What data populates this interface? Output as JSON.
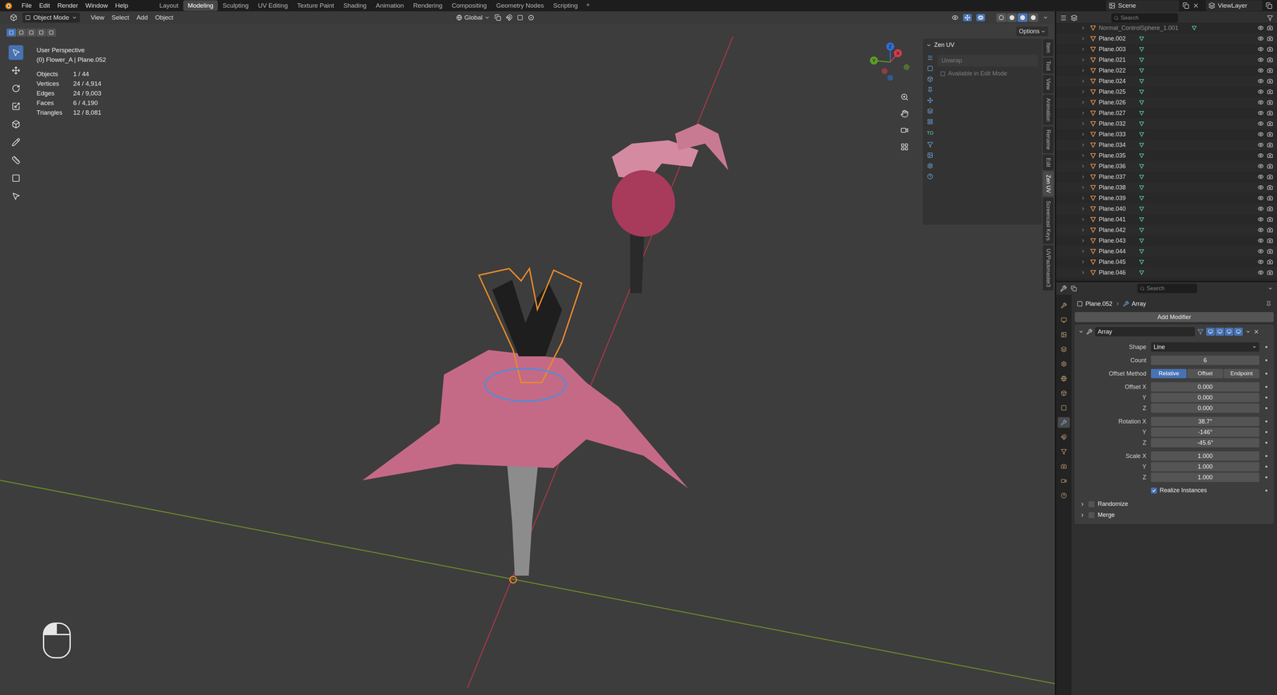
{
  "top_bar": {
    "menus": [
      "File",
      "Edit",
      "Render",
      "Window",
      "Help"
    ],
    "workspaces": [
      {
        "label": "Layout",
        "selected": false
      },
      {
        "label": "Modeling",
        "selected": true
      },
      {
        "label": "Sculpting",
        "selected": false
      },
      {
        "label": "UV Editing",
        "selected": false
      },
      {
        "label": "Texture Paint",
        "selected": false
      },
      {
        "label": "Shading",
        "selected": false
      },
      {
        "label": "Animation",
        "selected": false
      },
      {
        "label": "Rendering",
        "selected": false
      },
      {
        "label": "Compositing",
        "selected": false
      },
      {
        "label": "Geometry Nodes",
        "selected": false
      },
      {
        "label": "Scripting",
        "selected": false
      }
    ],
    "add_workspace": "+",
    "scene": "Scene",
    "view_layer": "ViewLayer"
  },
  "viewport": {
    "header": {
      "mode": "Object Mode",
      "menus": [
        "View",
        "Select",
        "Add",
        "Object"
      ],
      "orientation": "Global",
      "options": "Options",
      "shading": [
        {
          "selected": false
        },
        {
          "selected": false
        },
        {
          "selected": true
        },
        {
          "selected": false
        }
      ]
    },
    "select_modes": [
      {
        "selected": true
      },
      {
        "selected": false
      },
      {
        "selected": false
      },
      {
        "selected": false
      },
      {
        "selected": false
      }
    ],
    "tools": [
      {
        "selected": true
      },
      {
        "selected": false
      },
      {
        "selected": false
      },
      {
        "selected": false
      },
      {
        "selected": false
      },
      {
        "selected": false
      },
      {
        "selected": false
      },
      {
        "selected": false
      },
      {
        "selected": false
      }
    ],
    "overlay": {
      "perspective": "User Perspective",
      "context": "(0) Flower_A | Plane.052",
      "stats": [
        {
          "label": "Objects",
          "value": "1 / 44"
        },
        {
          "label": "Vertices",
          "value": "24 / 4,914"
        },
        {
          "label": "Edges",
          "value": "24 / 9,003"
        },
        {
          "label": "Faces",
          "value": "6 / 4,190"
        },
        {
          "label": "Triangles",
          "value": "12 / 8,081"
        }
      ]
    },
    "gizmo": [
      {
        "label": "Z",
        "color": "#2f6fd6"
      },
      {
        "label": "Y",
        "color": "#5d9c27"
      },
      {
        "label": "X",
        "color": "#d23c4e"
      }
    ],
    "sidebar": {
      "title": "Zen UV",
      "section": "Unwrap",
      "note": "Available in Edit Mode",
      "icon_label": "TD",
      "tabs": [
        {
          "label": "Item",
          "selected": false
        },
        {
          "label": "Tool",
          "selected": false
        },
        {
          "label": "View",
          "selected": false
        },
        {
          "label": "Animation",
          "selected": false
        },
        {
          "label": "Rename",
          "selected": false
        },
        {
          "label": "Edit",
          "selected": false
        },
        {
          "label": "Zen UV",
          "selected": true
        },
        {
          "label": "Screencast Keys",
          "selected": false
        },
        {
          "label": "UVPackmaster3",
          "selected": false
        }
      ]
    }
  },
  "outliner": {
    "search_placeholder": "Search",
    "rows": [
      {
        "name": "Normal_ControlSphere_1.001",
        "dimmed": true
      },
      {
        "name": "Plane.002",
        "dimmed": false
      },
      {
        "name": "Plane.003",
        "dimmed": false
      },
      {
        "name": "Plane.021",
        "dimmed": false
      },
      {
        "name": "Plane.022",
        "dimmed": false
      },
      {
        "name": "Plane.024",
        "dimmed": false
      },
      {
        "name": "Plane.025",
        "dimmed": false
      },
      {
        "name": "Plane.026",
        "dimmed": false
      },
      {
        "name": "Plane.027",
        "dimmed": false
      },
      {
        "name": "Plane.032",
        "dimmed": false
      },
      {
        "name": "Plane.033",
        "dimmed": false
      },
      {
        "name": "Plane.034",
        "dimmed": false
      },
      {
        "name": "Plane.035",
        "dimmed": false
      },
      {
        "name": "Plane.036",
        "dimmed": false
      },
      {
        "name": "Plane.037",
        "dimmed": false
      },
      {
        "name": "Plane.038",
        "dimmed": false
      },
      {
        "name": "Plane.039",
        "dimmed": false
      },
      {
        "name": "Plane.040",
        "dimmed": false
      },
      {
        "name": "Plane.041",
        "dimmed": false
      },
      {
        "name": "Plane.042",
        "dimmed": false
      },
      {
        "name": "Plane.043",
        "dimmed": false
      },
      {
        "name": "Plane.044",
        "dimmed": false
      },
      {
        "name": "Plane.045",
        "dimmed": false
      },
      {
        "name": "Plane.046",
        "dimmed": false
      }
    ]
  },
  "properties": {
    "search_placeholder": "Search",
    "object": "Plane.052",
    "modifier_crumb": "Array",
    "add_modifier": "Add Modifier",
    "tabs": [
      {
        "selected": false
      },
      {
        "selected": false
      },
      {
        "selected": false
      },
      {
        "selected": false
      },
      {
        "selected": false
      },
      {
        "selected": false
      },
      {
        "selected": false
      },
      {
        "selected": false
      },
      {
        "selected": true
      },
      {
        "selected": false
      },
      {
        "selected": false
      },
      {
        "selected": false
      },
      {
        "selected": false
      },
      {
        "selected": false
      }
    ],
    "modifier": {
      "name": "Array",
      "expanded": true,
      "toggles": [
        {
          "on": true
        },
        {
          "on": true
        },
        {
          "on": true
        },
        {
          "on": true
        }
      ],
      "rows": [
        {
          "kind": "select",
          "label": "Shape",
          "value": "Line"
        },
        {
          "kind": "number",
          "label": "Count",
          "value": "6"
        },
        {
          "kind": "segmented",
          "label": "Offset Method",
          "options": [
            {
              "label": "Relative",
              "selected": true
            },
            {
              "label": "Offset",
              "selected": false
            },
            {
              "label": "Endpoint",
              "selected": false
            }
          ]
        },
        {
          "kind": "number",
          "label": "Offset X",
          "value": "0.000"
        },
        {
          "kind": "number",
          "label": "Y",
          "value": "0.000"
        },
        {
          "kind": "number",
          "label": "Z",
          "value": "0.000"
        },
        {
          "kind": "number",
          "label": "Rotation X",
          "value": "38.7°"
        },
        {
          "kind": "number",
          "label": "Y",
          "value": "-146°"
        },
        {
          "kind": "number",
          "label": "Z",
          "value": "-45.6°"
        },
        {
          "kind": "number",
          "label": "Scale X",
          "value": "1.000"
        },
        {
          "kind": "number",
          "label": "Y",
          "value": "1.000"
        },
        {
          "kind": "number",
          "label": "Z",
          "value": "1.000"
        },
        {
          "kind": "checkbox",
          "label": "Realize Instances",
          "checked": true
        }
      ],
      "subpanels": [
        {
          "label": "Randomize",
          "checked": false,
          "expanded": false
        },
        {
          "label": "Merge",
          "checked": false,
          "expanded": false
        }
      ]
    }
  }
}
